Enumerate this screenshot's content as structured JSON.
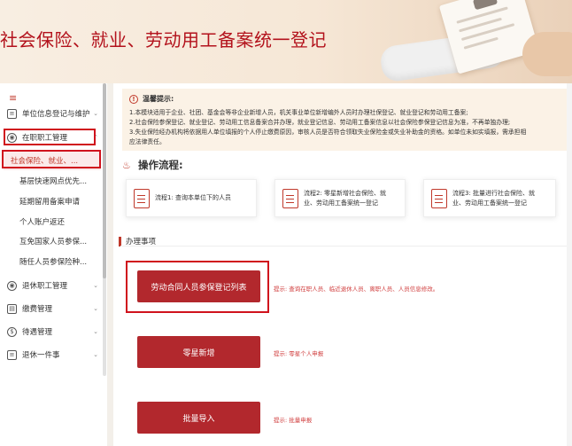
{
  "banner": {
    "title": "社会保险、就业、劳动用工备案统一登记"
  },
  "sidebar": {
    "top_icon": "≡",
    "items": [
      {
        "label": "单位信息登记与维护",
        "icon": "document-icon"
      },
      {
        "label": "在职职工管理",
        "icon": "user-icon"
      }
    ],
    "sub_items": [
      "社会保险、就业、...",
      "基层快速网点优先...",
      "延期留用备案申请",
      "个人账户返还",
      "互免国家人员参保...",
      "随任人员参保险种..."
    ],
    "bottom_items": [
      {
        "label": "退休职工管理",
        "icon": "user-icon"
      },
      {
        "label": "缴费管理",
        "icon": "wallet-icon"
      },
      {
        "label": "待遇管理",
        "icon": "coin-icon"
      },
      {
        "label": "退休一件事",
        "icon": "document-icon"
      }
    ]
  },
  "notice": {
    "title": "温馨提示:",
    "lines": [
      "1.本模块适用于企业、社团、基金会等非企业新增人员，机关事业单位新增编外人员时办理社保登记、就业登记和劳动用工备案;",
      "2.社会保险参保登记、就业登记、劳动用工信息备案合并办理，就业登记信息、劳动用工备案信息以社会保险参保登记信息为准，不再单独办理;",
      "3.失业保险经办机构将依据用人单位填报的个人停止缴费原因，审核人员是否符合领取失业保险金或失业补助金的资格。如单位未如实填报，需承担相",
      "应法律责任。"
    ]
  },
  "process": {
    "title": "操作流程:",
    "steps": [
      {
        "line1": "流程1: 查询本单位下的人员",
        "line2": ""
      },
      {
        "line1": "流程2: 零星新增社会保险、就",
        "line2": "业、劳动用工备案统一登记"
      },
      {
        "line1": "流程3: 批量进行社会保险、就",
        "line2": "业、劳动用工备案统一登记"
      }
    ]
  },
  "section": {
    "title": "办理事项"
  },
  "actions": [
    {
      "label": "劳动合同人员参保登记列表",
      "tip": "提示: 查询在职人员、临近退休人员、离职人员、人员信息修改。"
    },
    {
      "label": "零星新增",
      "tip": "提示: 零星个人申报"
    },
    {
      "label": "批量导入",
      "tip": "提示: 批量申报"
    }
  ],
  "colors": {
    "brand_red": "#b2282d",
    "highlight_box": "#d0121d",
    "notice_bg": "#fbf2e6"
  }
}
